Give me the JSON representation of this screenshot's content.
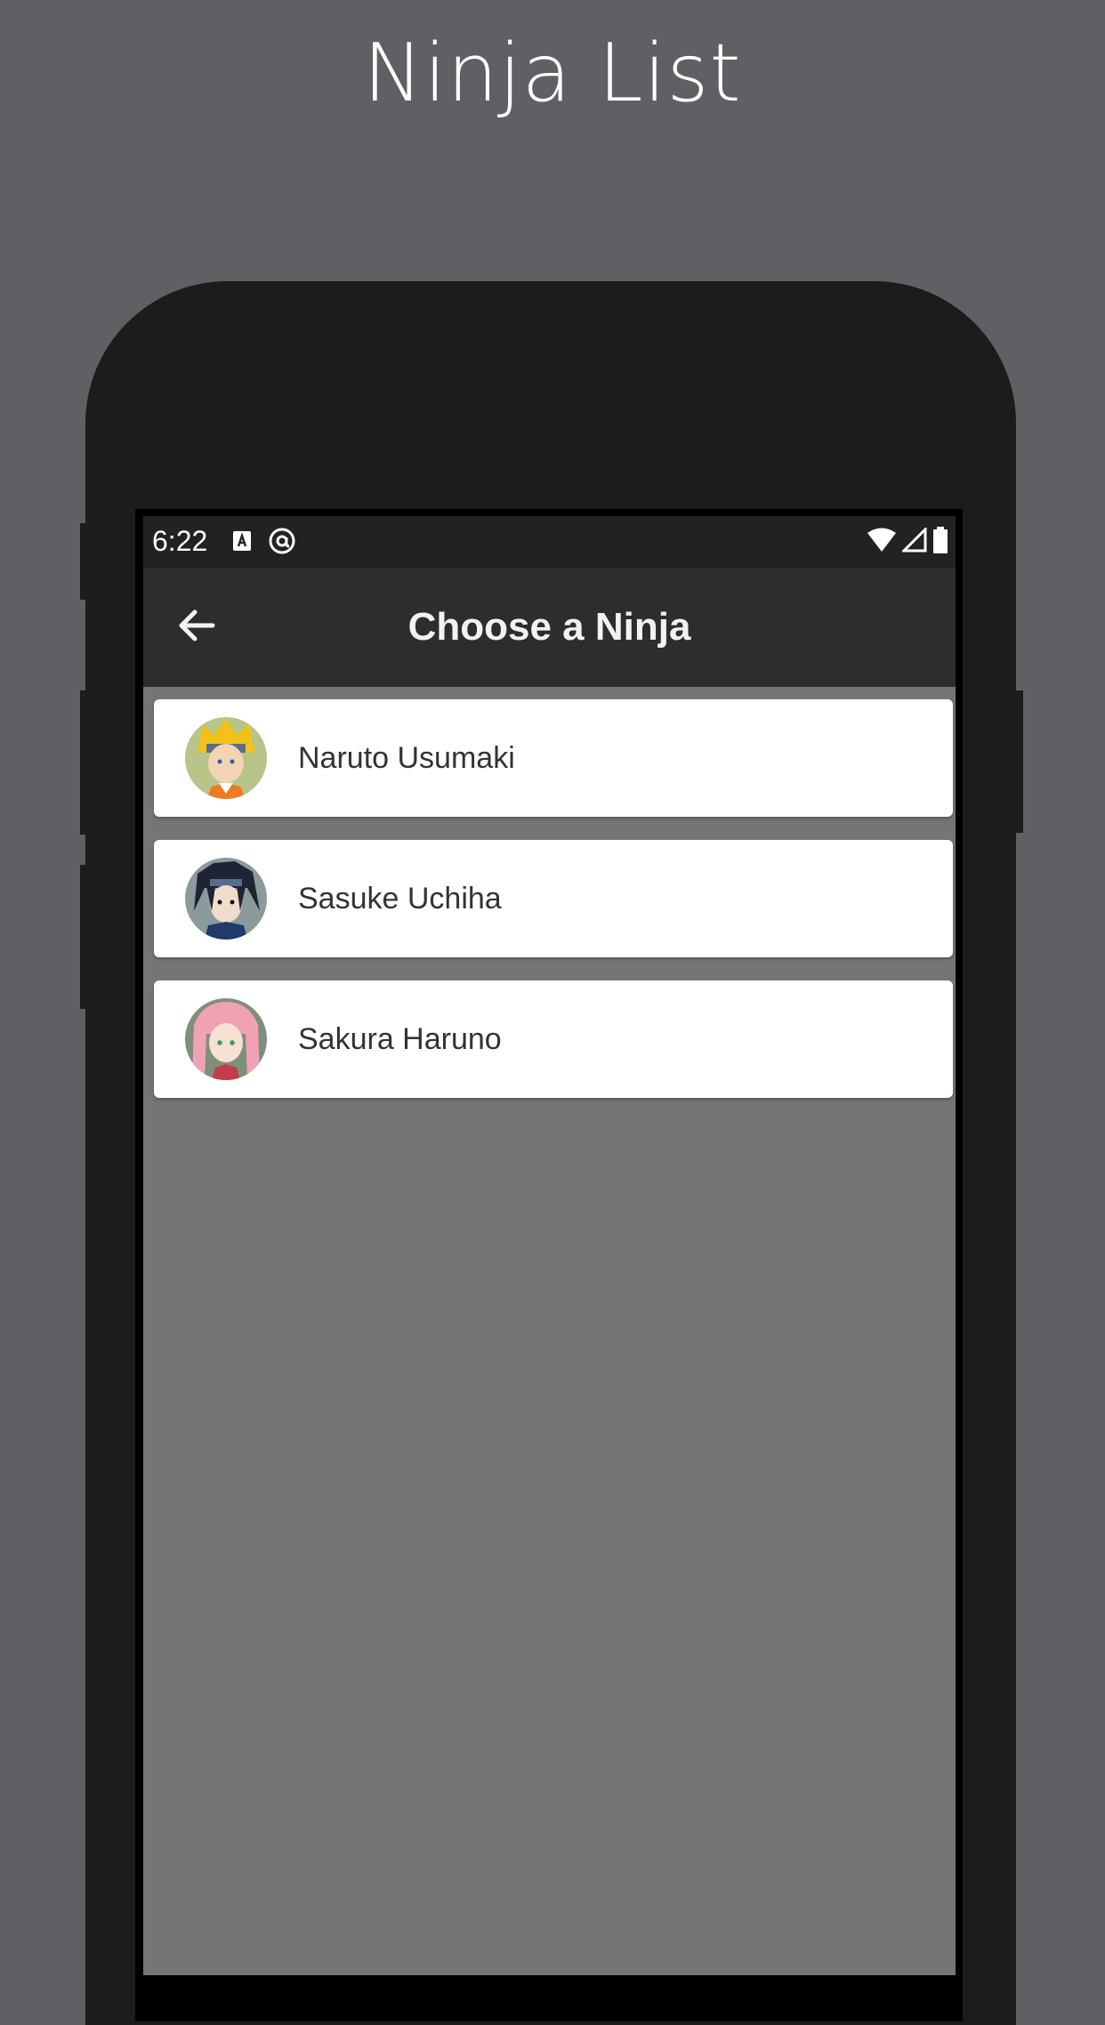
{
  "page": {
    "title": "Ninja List"
  },
  "status_bar": {
    "time": "6:22",
    "left_icons": [
      "notification-a-icon",
      "at-sign-icon"
    ],
    "right_icons": [
      "wifi-icon",
      "cell-signal-icon",
      "battery-icon"
    ]
  },
  "app_bar": {
    "back_icon": "arrow-left-icon",
    "title": "Choose a Ninja"
  },
  "ninjas": [
    {
      "name": "Naruto Usumaki",
      "avatar": "naruto-avatar",
      "hair_color": "#f2c21a",
      "skin_color": "#f4d2b4",
      "outfit_color": "#f07a24"
    },
    {
      "name": "Sasuke Uchiha",
      "avatar": "sasuke-avatar",
      "hair_color": "#1e2433",
      "skin_color": "#f1dccb",
      "outfit_color": "#1f3a6b"
    },
    {
      "name": "Sakura Haruno",
      "avatar": "sakura-avatar",
      "hair_color": "#f1a1b4",
      "skin_color": "#f7e1d3",
      "outfit_color": "#c43b4b"
    }
  ],
  "colors": {
    "page_background": "#5f5f64",
    "phone_body": "#1c1c1c",
    "status_bar": "#222222",
    "app_bar": "#2d2d2d",
    "screen_background": "#757575",
    "card_background": "#ffffff"
  }
}
